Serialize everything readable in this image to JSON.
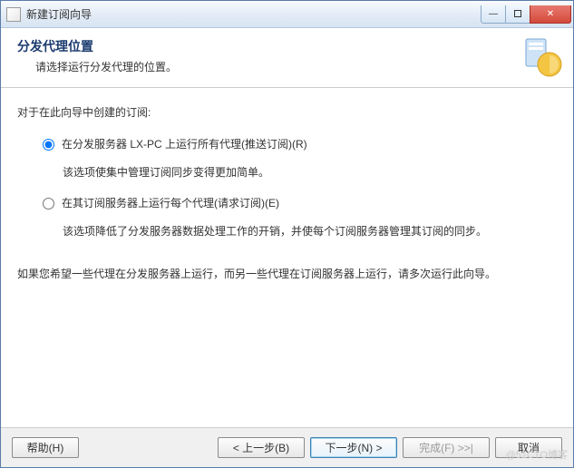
{
  "titlebar": {
    "title": "新建订阅向导"
  },
  "header": {
    "title": "分发代理位置",
    "subtitle": "请选择运行分发代理的位置。"
  },
  "content": {
    "intro": "对于在此向导中创建的订阅:",
    "option1": {
      "label": "在分发服务器 LX-PC 上运行所有代理(推送订阅)(R)",
      "desc": "该选项使集中管理订阅同步变得更加简单。",
      "checked": true
    },
    "option2": {
      "label": "在其订阅服务器上运行每个代理(请求订阅)(E)",
      "desc": "该选项降低了分发服务器数据处理工作的开销，并使每个订阅服务器管理其订阅的同步。",
      "checked": false
    },
    "note": "如果您希望一些代理在分发服务器上运行，而另一些代理在订阅服务器上运行，请多次运行此向导。"
  },
  "footer": {
    "help": "帮助(H)",
    "back": "< 上一步(B)",
    "next": "下一步(N) >",
    "finish": "完成(F) >>|",
    "cancel": "取消"
  },
  "watermark": "@51CTO博客"
}
